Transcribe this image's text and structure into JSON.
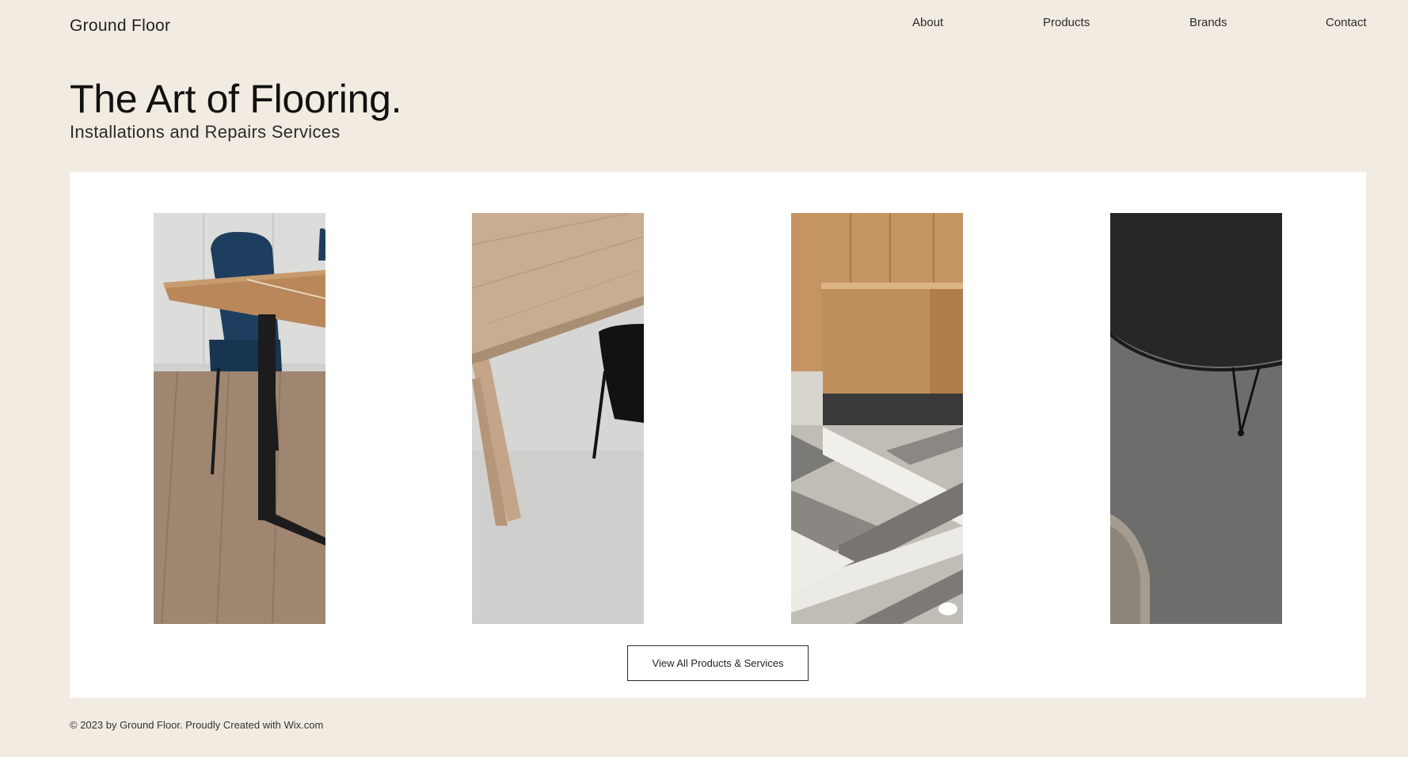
{
  "site": {
    "name": "Ground Floor"
  },
  "nav": {
    "items": [
      {
        "label": "About"
      },
      {
        "label": "Products"
      },
      {
        "label": "Brands"
      },
      {
        "label": "Contact"
      }
    ]
  },
  "hero": {
    "title": "The Art of Flooring.",
    "subtitle": "Installations and Repairs Services"
  },
  "gallery": {
    "images": [
      {
        "subject": "dining-table-wood-floor"
      },
      {
        "subject": "wood-table-concrete-floor"
      },
      {
        "subject": "herringbone-tile-floor"
      },
      {
        "subject": "dark-table-grey-rug"
      }
    ],
    "cta_label": "View All Products & Services"
  },
  "footer": {
    "text": "© 2023 by Ground Floor. Proudly Created with Wix.com"
  },
  "colors": {
    "page_background": "#f2ebe1",
    "panel_background": "#ffffff",
    "text": "#1f1f1f"
  }
}
